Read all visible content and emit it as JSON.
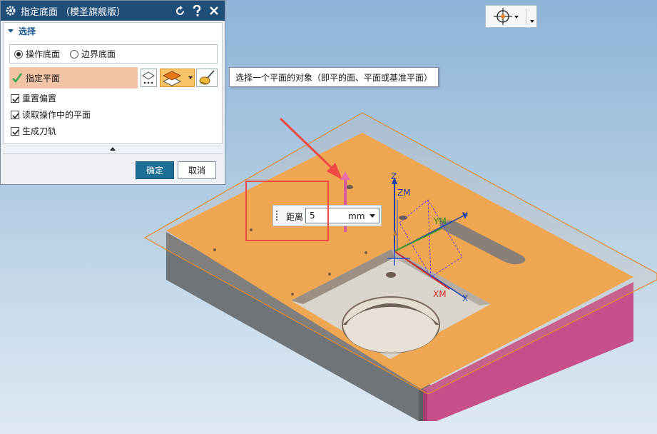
{
  "dialog": {
    "title": "指定底面 （模圣旗舰版）",
    "section_title": "选择",
    "radio_options": [
      {
        "label": "操作底面",
        "selected": true
      },
      {
        "label": "边界底面",
        "selected": false
      }
    ],
    "specify_plane_label": "指定平面",
    "checkboxes": [
      {
        "label": "重置偏置",
        "checked": true
      },
      {
        "label": "读取操作中的平面",
        "checked": true
      },
      {
        "label": "生成刀轨",
        "checked": true
      }
    ],
    "ok_label": "确定",
    "cancel_label": "取消"
  },
  "tooltip": {
    "text": "选择一个平面的对象（即平的面、平面或基准平面）"
  },
  "distance": {
    "label": "距离",
    "value": "5",
    "unit": "mm"
  },
  "csys": {
    "z_label": "Z",
    "zm_label": "ZM",
    "ym_label": "YM",
    "y_label": "Y",
    "xm_label": "XM",
    "x_label": "X"
  },
  "colors": {
    "title_bar": "#1f4e79",
    "part_face": "#f6a443",
    "selected_row": "#f2c3a4",
    "ok_button": "#1e6f96",
    "highlight_box": "#ee4a44"
  }
}
